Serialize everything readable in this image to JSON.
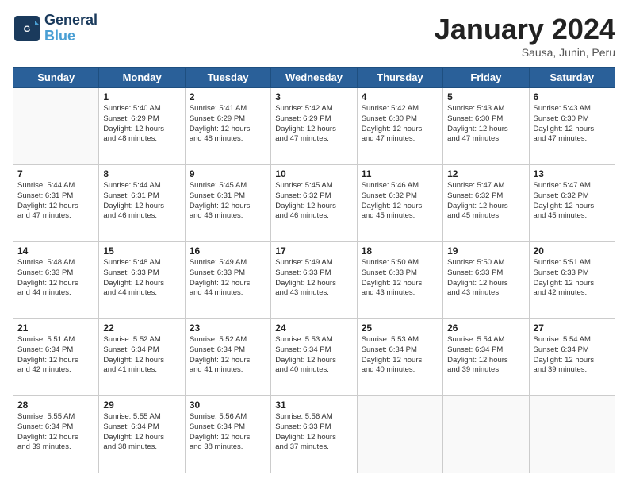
{
  "header": {
    "logo_line1": "General",
    "logo_line2": "Blue",
    "month_title": "January 2024",
    "subtitle": "Sausa, Junin, Peru"
  },
  "weekdays": [
    "Sunday",
    "Monday",
    "Tuesday",
    "Wednesday",
    "Thursday",
    "Friday",
    "Saturday"
  ],
  "weeks": [
    [
      {
        "day": "",
        "text": ""
      },
      {
        "day": "1",
        "text": "Sunrise: 5:40 AM\nSunset: 6:29 PM\nDaylight: 12 hours\nand 48 minutes."
      },
      {
        "day": "2",
        "text": "Sunrise: 5:41 AM\nSunset: 6:29 PM\nDaylight: 12 hours\nand 48 minutes."
      },
      {
        "day": "3",
        "text": "Sunrise: 5:42 AM\nSunset: 6:29 PM\nDaylight: 12 hours\nand 47 minutes."
      },
      {
        "day": "4",
        "text": "Sunrise: 5:42 AM\nSunset: 6:30 PM\nDaylight: 12 hours\nand 47 minutes."
      },
      {
        "day": "5",
        "text": "Sunrise: 5:43 AM\nSunset: 6:30 PM\nDaylight: 12 hours\nand 47 minutes."
      },
      {
        "day": "6",
        "text": "Sunrise: 5:43 AM\nSunset: 6:30 PM\nDaylight: 12 hours\nand 47 minutes."
      }
    ],
    [
      {
        "day": "7",
        "text": "Sunrise: 5:44 AM\nSunset: 6:31 PM\nDaylight: 12 hours\nand 47 minutes."
      },
      {
        "day": "8",
        "text": "Sunrise: 5:44 AM\nSunset: 6:31 PM\nDaylight: 12 hours\nand 46 minutes."
      },
      {
        "day": "9",
        "text": "Sunrise: 5:45 AM\nSunset: 6:31 PM\nDaylight: 12 hours\nand 46 minutes."
      },
      {
        "day": "10",
        "text": "Sunrise: 5:45 AM\nSunset: 6:32 PM\nDaylight: 12 hours\nand 46 minutes."
      },
      {
        "day": "11",
        "text": "Sunrise: 5:46 AM\nSunset: 6:32 PM\nDaylight: 12 hours\nand 45 minutes."
      },
      {
        "day": "12",
        "text": "Sunrise: 5:47 AM\nSunset: 6:32 PM\nDaylight: 12 hours\nand 45 minutes."
      },
      {
        "day": "13",
        "text": "Sunrise: 5:47 AM\nSunset: 6:32 PM\nDaylight: 12 hours\nand 45 minutes."
      }
    ],
    [
      {
        "day": "14",
        "text": "Sunrise: 5:48 AM\nSunset: 6:33 PM\nDaylight: 12 hours\nand 44 minutes."
      },
      {
        "day": "15",
        "text": "Sunrise: 5:48 AM\nSunset: 6:33 PM\nDaylight: 12 hours\nand 44 minutes."
      },
      {
        "day": "16",
        "text": "Sunrise: 5:49 AM\nSunset: 6:33 PM\nDaylight: 12 hours\nand 44 minutes."
      },
      {
        "day": "17",
        "text": "Sunrise: 5:49 AM\nSunset: 6:33 PM\nDaylight: 12 hours\nand 43 minutes."
      },
      {
        "day": "18",
        "text": "Sunrise: 5:50 AM\nSunset: 6:33 PM\nDaylight: 12 hours\nand 43 minutes."
      },
      {
        "day": "19",
        "text": "Sunrise: 5:50 AM\nSunset: 6:33 PM\nDaylight: 12 hours\nand 43 minutes."
      },
      {
        "day": "20",
        "text": "Sunrise: 5:51 AM\nSunset: 6:33 PM\nDaylight: 12 hours\nand 42 minutes."
      }
    ],
    [
      {
        "day": "21",
        "text": "Sunrise: 5:51 AM\nSunset: 6:34 PM\nDaylight: 12 hours\nand 42 minutes."
      },
      {
        "day": "22",
        "text": "Sunrise: 5:52 AM\nSunset: 6:34 PM\nDaylight: 12 hours\nand 41 minutes."
      },
      {
        "day": "23",
        "text": "Sunrise: 5:52 AM\nSunset: 6:34 PM\nDaylight: 12 hours\nand 41 minutes."
      },
      {
        "day": "24",
        "text": "Sunrise: 5:53 AM\nSunset: 6:34 PM\nDaylight: 12 hours\nand 40 minutes."
      },
      {
        "day": "25",
        "text": "Sunrise: 5:53 AM\nSunset: 6:34 PM\nDaylight: 12 hours\nand 40 minutes."
      },
      {
        "day": "26",
        "text": "Sunrise: 5:54 AM\nSunset: 6:34 PM\nDaylight: 12 hours\nand 39 minutes."
      },
      {
        "day": "27",
        "text": "Sunrise: 5:54 AM\nSunset: 6:34 PM\nDaylight: 12 hours\nand 39 minutes."
      }
    ],
    [
      {
        "day": "28",
        "text": "Sunrise: 5:55 AM\nSunset: 6:34 PM\nDaylight: 12 hours\nand 39 minutes."
      },
      {
        "day": "29",
        "text": "Sunrise: 5:55 AM\nSunset: 6:34 PM\nDaylight: 12 hours\nand 38 minutes."
      },
      {
        "day": "30",
        "text": "Sunrise: 5:56 AM\nSunset: 6:34 PM\nDaylight: 12 hours\nand 38 minutes."
      },
      {
        "day": "31",
        "text": "Sunrise: 5:56 AM\nSunset: 6:33 PM\nDaylight: 12 hours\nand 37 minutes."
      },
      {
        "day": "",
        "text": ""
      },
      {
        "day": "",
        "text": ""
      },
      {
        "day": "",
        "text": ""
      }
    ]
  ]
}
